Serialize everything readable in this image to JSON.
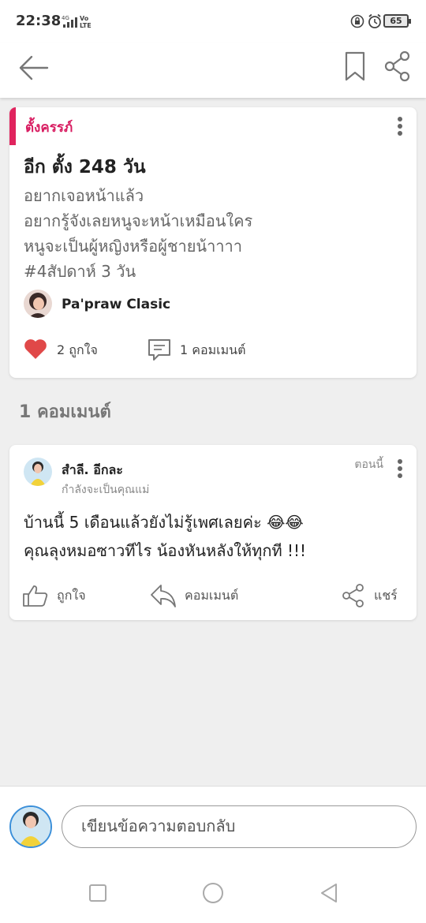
{
  "status_bar": {
    "time": "22:38",
    "battery": "65",
    "network": "4G VoLTE"
  },
  "app_bar": {
    "icons": [
      "back-arrow-icon",
      "bookmark-icon",
      "share-icon"
    ]
  },
  "post": {
    "category": "ตั้งครรภ์",
    "title": "อีก ตั้ง 248 วัน",
    "body": "อยากเจอหน้าแล้ว\nอยากรู้จังเลยหนูจะหน้าเหมือนใคร\nหนูจะเป็นผู้หญิงหรือผู้ชายน้าาาา\n#4สัปดาห์ 3 วัน",
    "author": "Pa'praw Clasic",
    "likes": "2 ถูกใจ",
    "comments": "1 คอมเมนต์"
  },
  "comments_section": {
    "label": "1 คอมเมนต์"
  },
  "comment": {
    "name": "สำลี. อีกละ",
    "subtitle": "กำลังจะเป็นคุณแม่",
    "time": "ตอนนี้",
    "text": "บ้านนี้ 5 เดือนแล้วยังไม่รู้เพศเลยค่ะ 😂😂\nคุณลุงหมอซาวทีไร  น้องหันหลังให้ทุกที !!!",
    "like_label": "ถูกใจ",
    "reply_label": "คอมเมนต์",
    "share_label": "แชร์"
  },
  "reply_bar": {
    "placeholder": "เขียนข้อความตอบกลับ"
  },
  "colors": {
    "accent": "#d81b60",
    "heart": "#e04848",
    "background": "#efefef"
  }
}
